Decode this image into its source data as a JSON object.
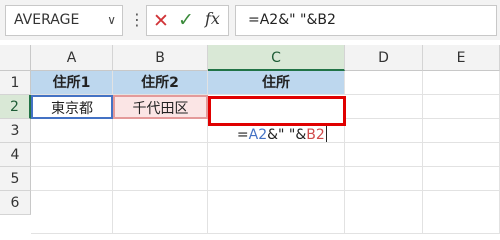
{
  "name_box": {
    "value": "AVERAGE",
    "dropdown_icon": "chevron-down-icon"
  },
  "toolbar": {
    "more_icon": "vertical-dots-icon",
    "cancel_icon": "x-icon",
    "enter_icon": "check-icon",
    "fx_label": "fx"
  },
  "formula_bar": {
    "text": "=A2&\" \"&B2"
  },
  "columns": [
    "A",
    "B",
    "C",
    "D",
    "E"
  ],
  "active_column": "C",
  "rows": [
    "1",
    "2",
    "3",
    "4",
    "5",
    "6"
  ],
  "active_row": "2",
  "cells": {
    "A1": "住所1",
    "B1": "住所2",
    "C1": "住所",
    "A2": "東京都",
    "B2": "千代田区"
  },
  "editing": {
    "prefix": "=",
    "ref1": "A2",
    "middle": "&\" \"&",
    "ref2": "B2"
  },
  "colors": {
    "header_fill": "#bdd7ee",
    "ref1": "#4472c4",
    "ref2": "#d14b4b",
    "highlight": "#e00000",
    "active_header": "#217346"
  }
}
